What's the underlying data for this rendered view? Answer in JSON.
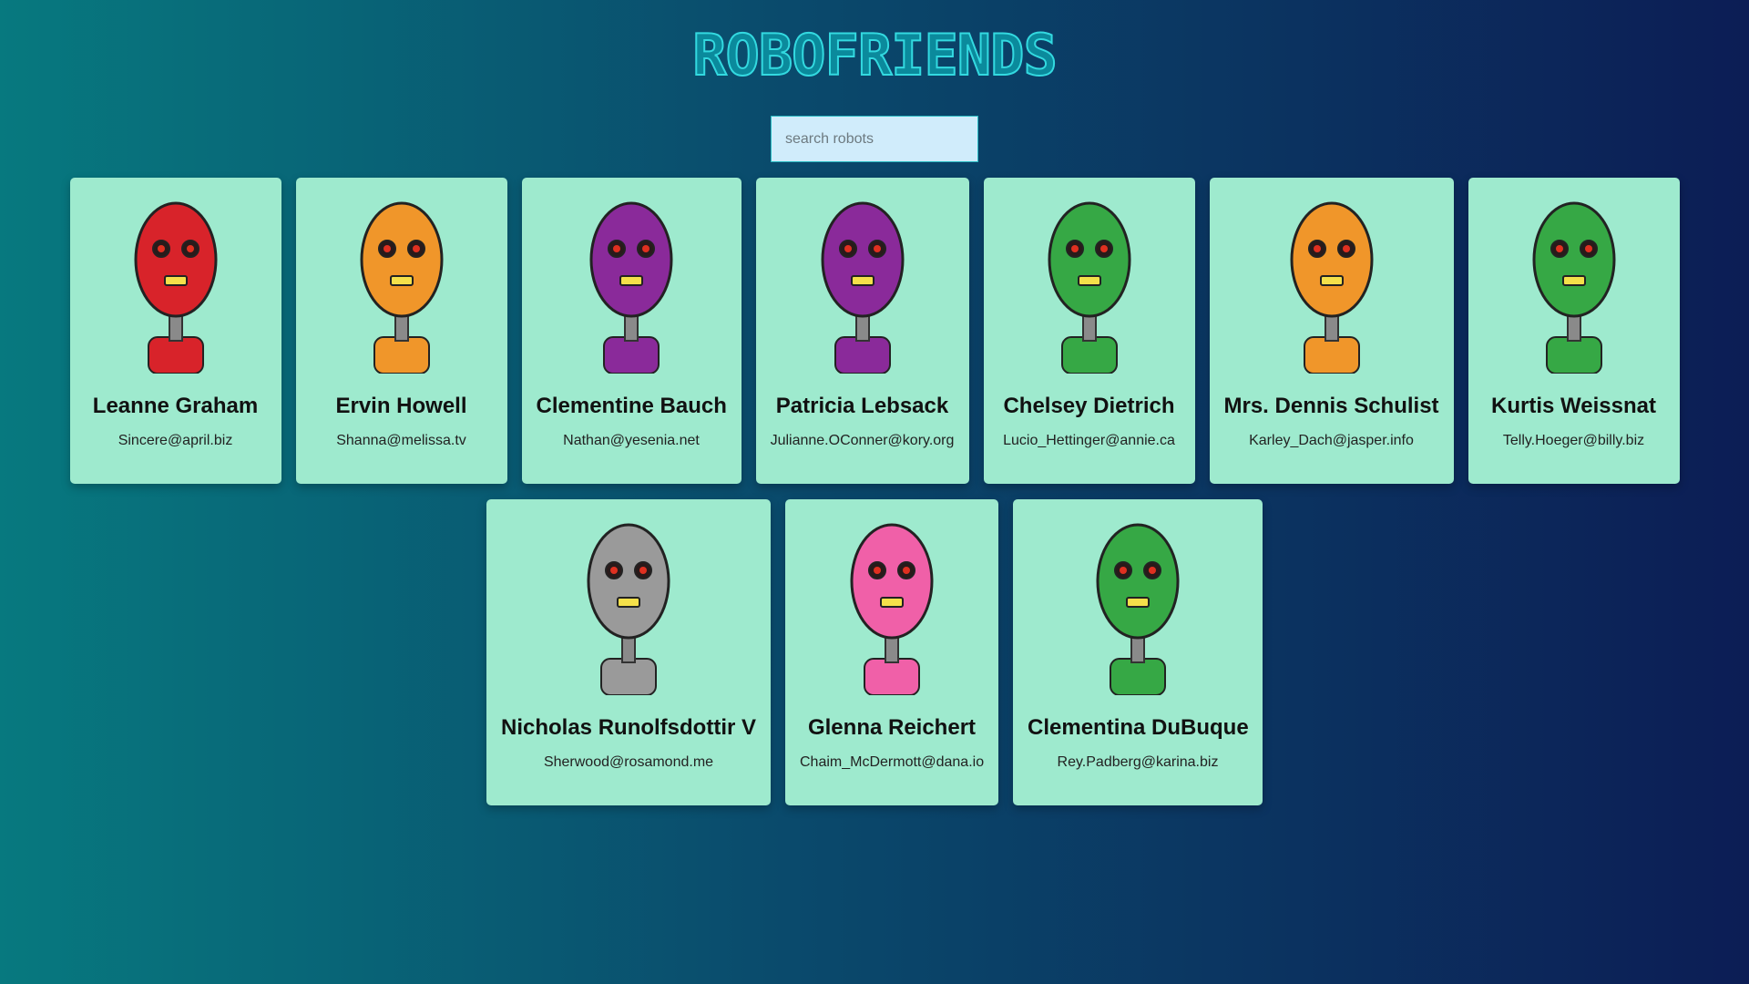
{
  "app": {
    "title": "ROBOFRIENDS"
  },
  "search": {
    "placeholder": "search robots",
    "value": ""
  },
  "robots": [
    {
      "name": "Leanne Graham",
      "email": "Sincere@april.biz",
      "color": "#d8232a",
      "avatar_icon": "red-robot-icon"
    },
    {
      "name": "Ervin Howell",
      "email": "Shanna@melissa.tv",
      "color": "#f0962a",
      "avatar_icon": "orange-robot-icon"
    },
    {
      "name": "Clementine Bauch",
      "email": "Nathan@yesenia.net",
      "color": "#8a2a9a",
      "avatar_icon": "purple-robot-icon"
    },
    {
      "name": "Patricia Lebsack",
      "email": "Julianne.OConner@kory.org",
      "color": "#8a2a9a",
      "avatar_icon": "purple-robot-icon"
    },
    {
      "name": "Chelsey Dietrich",
      "email": "Lucio_Hettinger@annie.ca",
      "color": "#36a845",
      "avatar_icon": "green-robot-icon"
    },
    {
      "name": "Mrs. Dennis Schulist",
      "email": "Karley_Dach@jasper.info",
      "color": "#f0962a",
      "avatar_icon": "orange-robot-icon"
    },
    {
      "name": "Kurtis Weissnat",
      "email": "Telly.Hoeger@billy.biz",
      "color": "#36a845",
      "avatar_icon": "green-robot-icon"
    },
    {
      "name": "Nicholas Runolfsdottir V",
      "email": "Sherwood@rosamond.me",
      "color": "#9a9a9a",
      "avatar_icon": "gray-robot-icon"
    },
    {
      "name": "Glenna Reichert",
      "email": "Chaim_McDermott@dana.io",
      "color": "#f060a8",
      "avatar_icon": "pink-robot-icon"
    },
    {
      "name": "Clementina DuBuque",
      "email": "Rey.Padberg@karina.biz",
      "color": "#36a845",
      "avatar_icon": "green-robot-icon"
    }
  ]
}
